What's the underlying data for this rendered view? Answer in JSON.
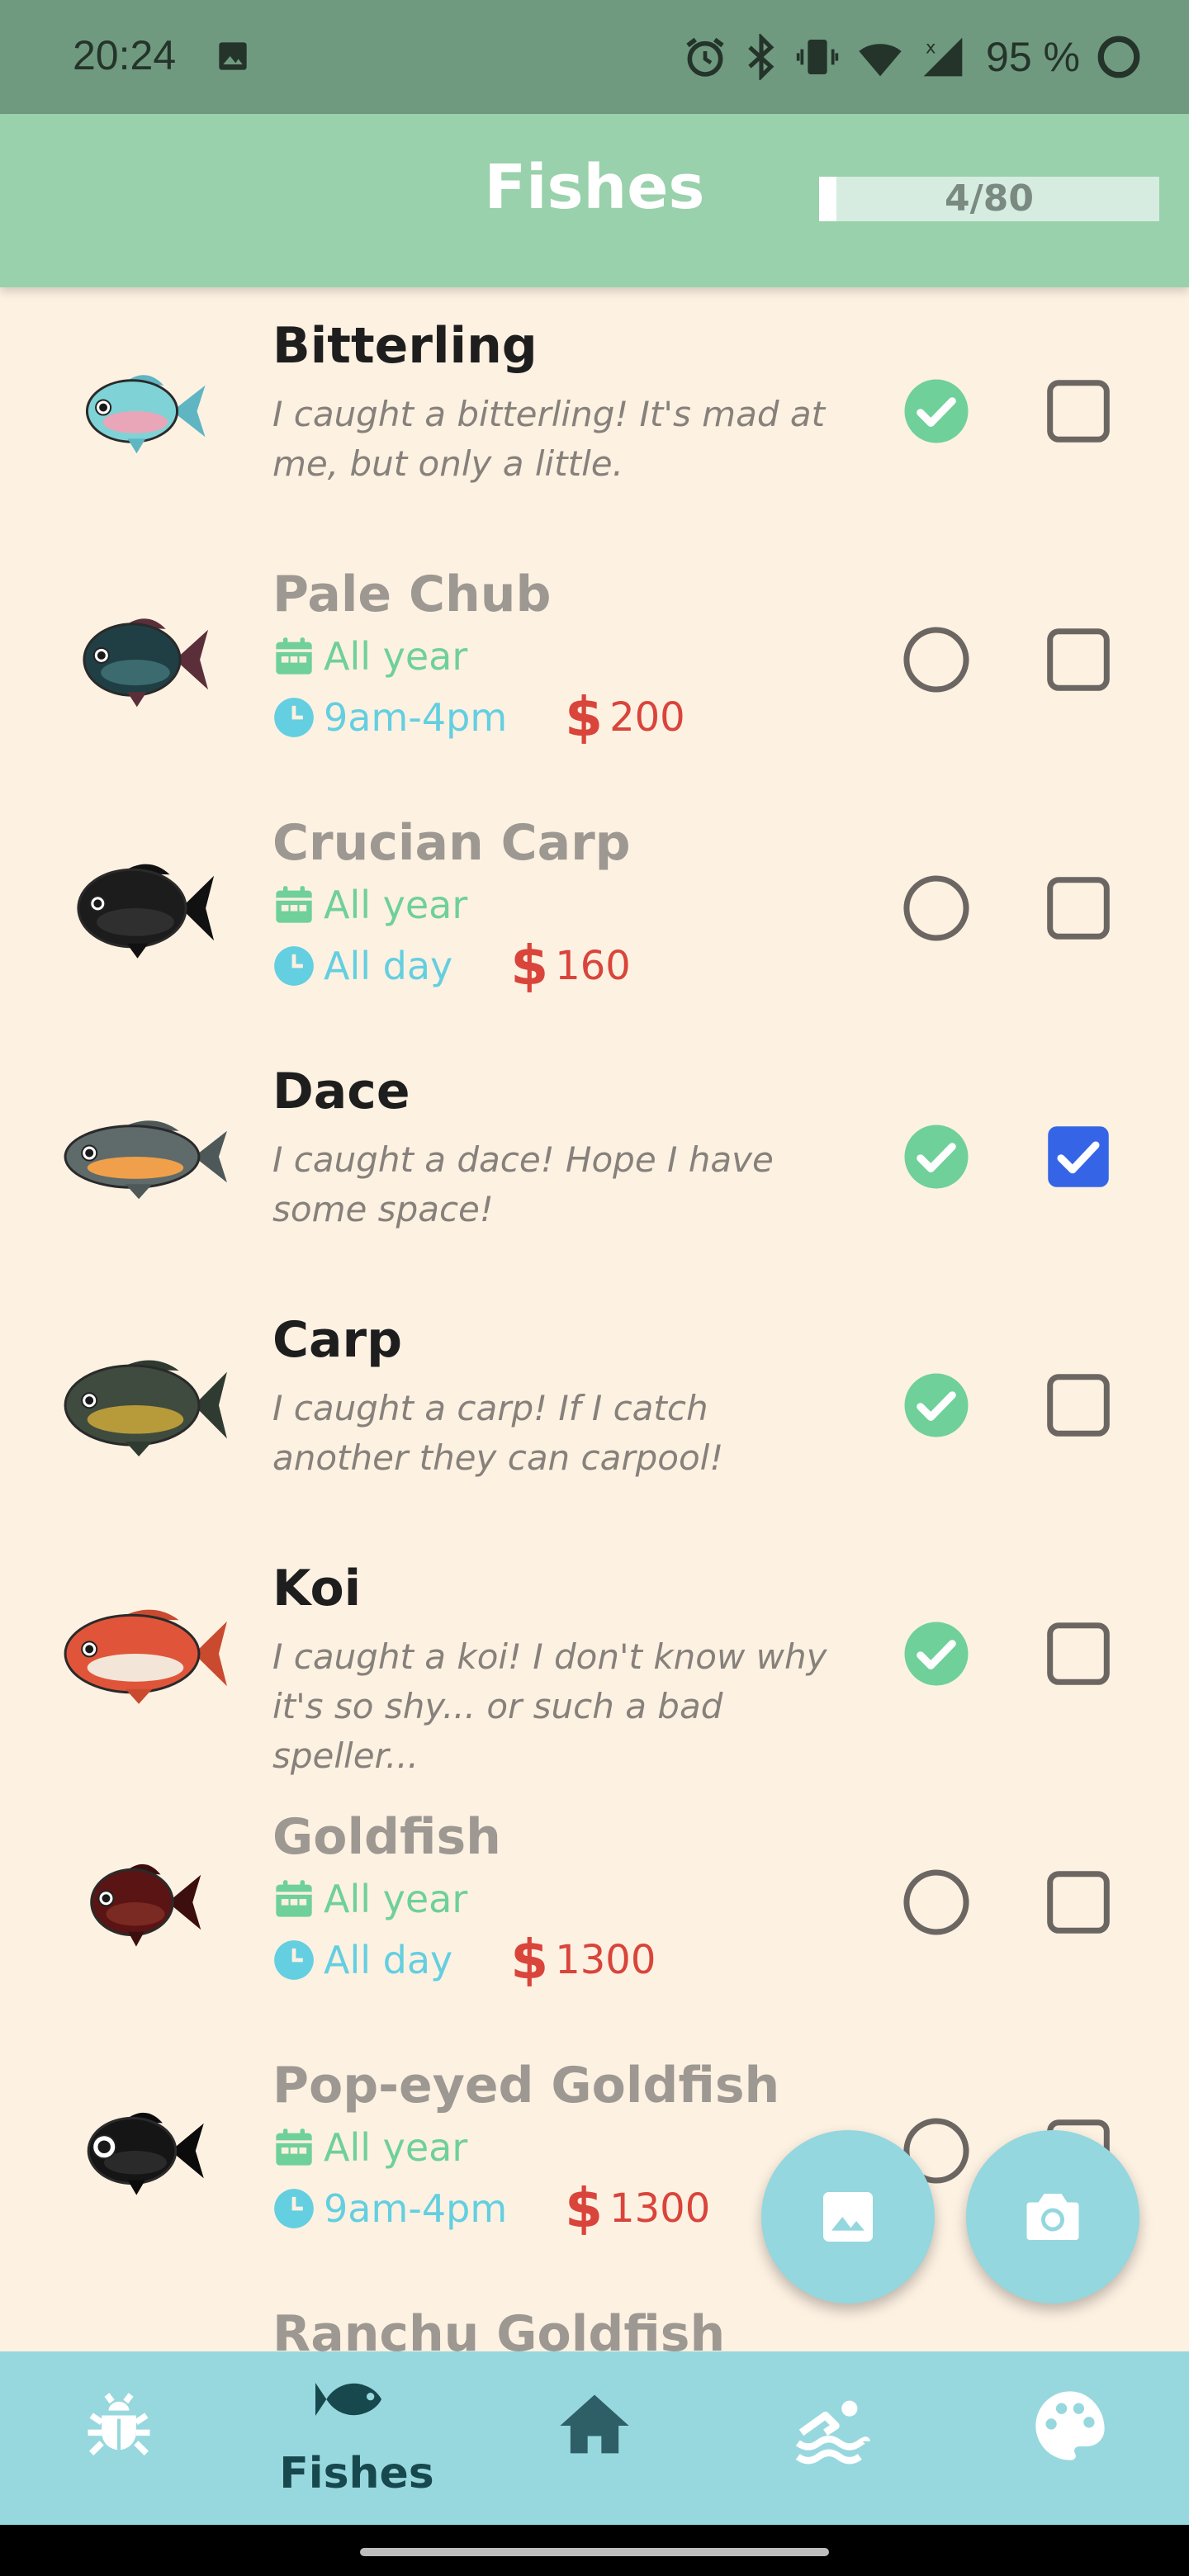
{
  "status_bar": {
    "time": "20:24",
    "battery": "95 %",
    "icons": [
      "gallery-icon",
      "alarm-icon",
      "bluetooth-icon",
      "vibrate-icon",
      "wifi-icon",
      "signal-icon",
      "battery-icon"
    ]
  },
  "header": {
    "title": "Fishes",
    "progress_text": "4/80",
    "progress_fraction": 0.05
  },
  "colors": {
    "status_bar": "#709a80",
    "app_bar": "#98d1ab",
    "background": "#fdf1e2",
    "caught_green": "#6fd09a",
    "donated_blue": "#3565e6",
    "time_cyan": "#63cfe0",
    "price_red": "#d9443b",
    "nav_bg": "#97d8df",
    "nav_icon": "#ffffff",
    "nav_active": "#17484e"
  },
  "fish": [
    {
      "name": "Bitterling",
      "caught": true,
      "donated": false,
      "quote": "I caught a bitterling! It's mad at me, but only a little.",
      "icon": "bitterling-fish-icon"
    },
    {
      "name": "Pale Chub",
      "caught": false,
      "donated": false,
      "season": "All year",
      "time": "9am-4pm",
      "price": "200",
      "icon": "pale-chub-fish-icon"
    },
    {
      "name": "Crucian Carp",
      "caught": false,
      "donated": false,
      "season": "All year",
      "time": "All day",
      "price": "160",
      "icon": "crucian-carp-fish-icon"
    },
    {
      "name": "Dace",
      "caught": true,
      "donated": true,
      "quote": "I caught a dace! Hope I have some space!",
      "icon": "dace-fish-icon"
    },
    {
      "name": "Carp",
      "caught": true,
      "donated": false,
      "quote": "I caught a carp! If I catch another they can carpool!",
      "icon": "carp-fish-icon"
    },
    {
      "name": "Koi",
      "caught": true,
      "donated": false,
      "quote": "I caught a koi! I don't know why it's so shy... or such a bad speller...",
      "icon": "koi-fish-icon"
    },
    {
      "name": "Goldfish",
      "caught": false,
      "donated": false,
      "season": "All year",
      "time": "All day",
      "price": "1300",
      "icon": "goldfish-fish-icon"
    },
    {
      "name": "Pop-eyed Goldfish",
      "caught": false,
      "donated": false,
      "season": "All year",
      "time": "9am-4pm",
      "price": "1300",
      "icon": "pop-eyed-goldfish-fish-icon"
    },
    {
      "name": "Ranchu Goldfish",
      "caught": false,
      "donated": false,
      "icon": "ranchu-goldfish-fish-icon"
    }
  ],
  "currency_symbol": "$",
  "fabs": [
    {
      "name": "gallery-fab",
      "icon": "image-icon"
    },
    {
      "name": "camera-fab",
      "icon": "camera-icon"
    }
  ],
  "bottom_nav": {
    "items": [
      {
        "id": "bugs",
        "icon": "bug-icon",
        "label": ""
      },
      {
        "id": "fishes",
        "icon": "fish-icon",
        "label": "Fishes",
        "active": true
      },
      {
        "id": "home",
        "icon": "home-icon",
        "label": ""
      },
      {
        "id": "sea-creatures",
        "icon": "swimmer-icon",
        "label": ""
      },
      {
        "id": "art",
        "icon": "palette-icon",
        "label": ""
      }
    ]
  }
}
